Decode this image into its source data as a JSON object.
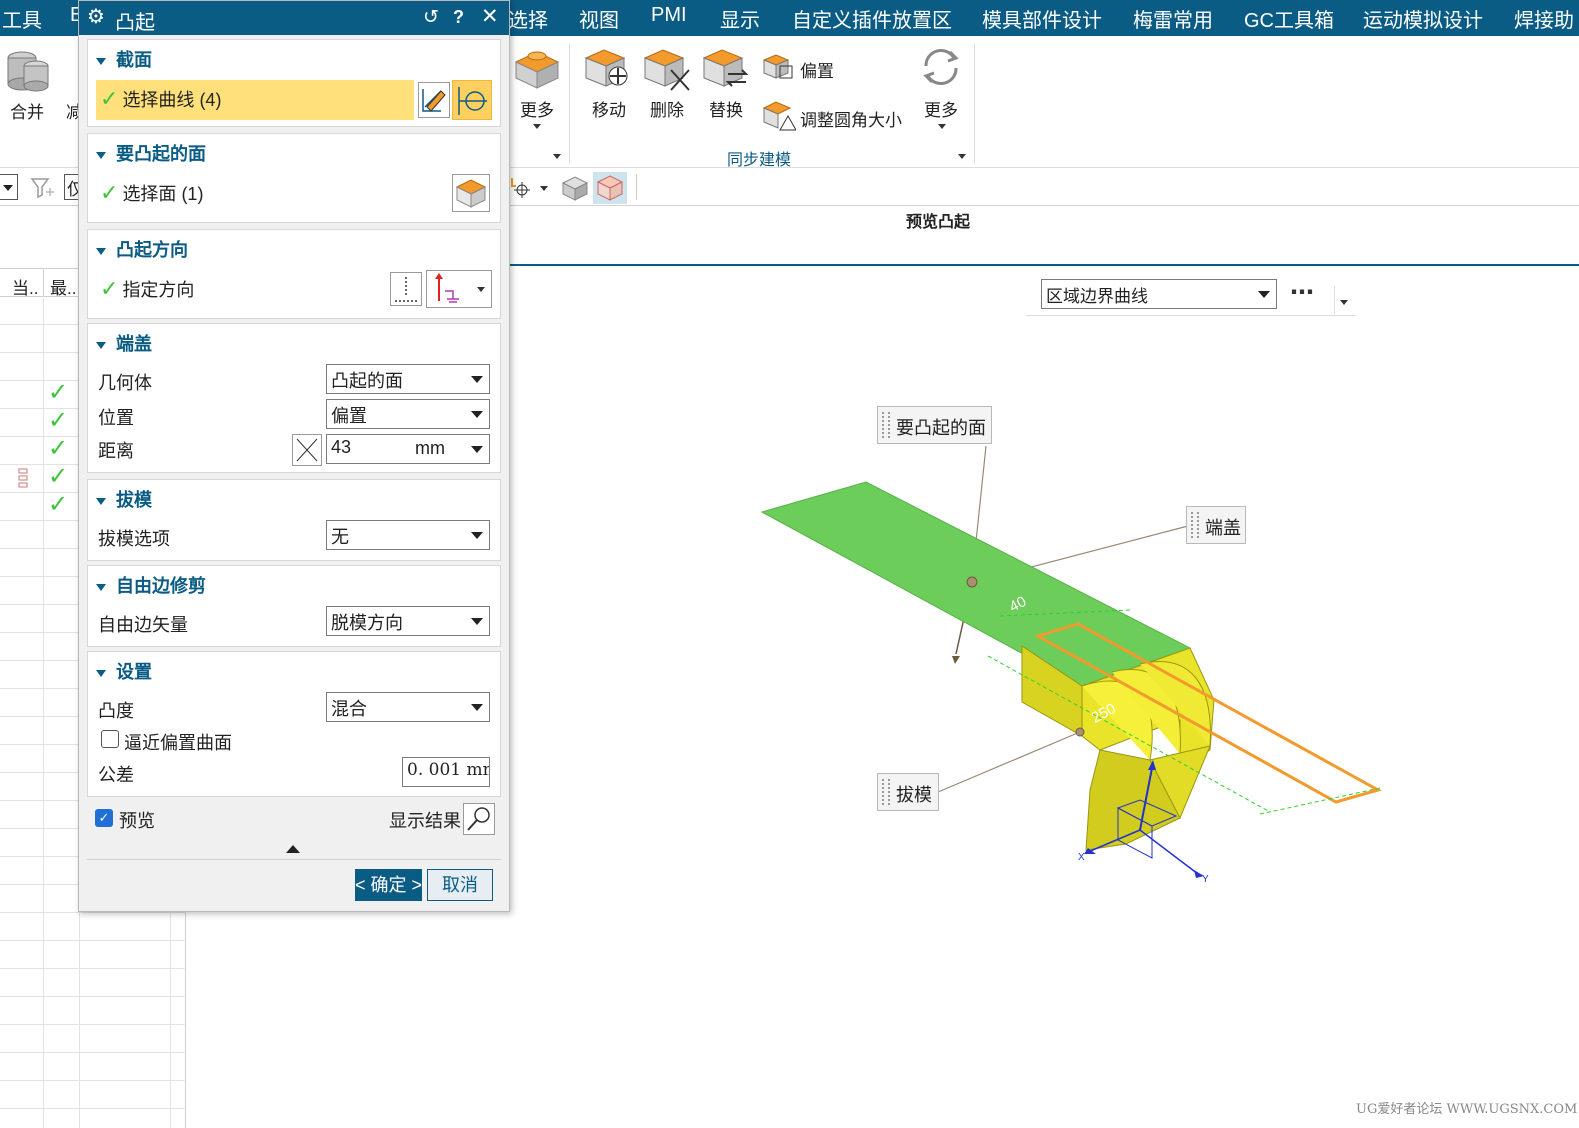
{
  "menubar": {
    "items_left": [
      "工具",
      "E"
    ],
    "items_right": [
      "选择",
      "视图",
      "PMI",
      "显示",
      "自定义插件放置区",
      "模具部件设计",
      "梅雷常用",
      "GC工具箱",
      "运动模拟设计",
      "焊接助"
    ]
  },
  "ribbon": {
    "unite_label": "合并",
    "subtract_label": "减",
    "more_label": "更多",
    "move_label": "移动",
    "delete_label": "删除",
    "replace_label": "替换",
    "offset_label": "偏置",
    "resize_blend_label": "调整圆角大小",
    "more2_label": "更多",
    "group_sync": "同步建模"
  },
  "toolbar2": {
    "filter_text": "仅"
  },
  "left_pane": {
    "col_current": "当..",
    "col_latest": "最.."
  },
  "viewport": {
    "preview_title": "预览凸起",
    "region_select": "区域边界曲线",
    "more_dots": "⋯",
    "callouts": {
      "face": "要凸起的面",
      "cap": "端盖",
      "draft": "拔模"
    },
    "dims": {
      "width": "40",
      "length": "250"
    },
    "triad": {
      "x": "X",
      "y": "Y"
    }
  },
  "dialog": {
    "title": "凸起",
    "section": {
      "header": "截面",
      "select_curve": "选择曲线 (4)"
    },
    "face": {
      "header": "要凸起的面",
      "select_face": "选择面 (1)"
    },
    "direction": {
      "header": "凸起方向",
      "specify": "指定方向"
    },
    "cap": {
      "header": "端盖",
      "geometry_label": "几何体",
      "geometry_value": "凸起的面",
      "location_label": "位置",
      "location_value": "偏置",
      "distance_label": "距离",
      "distance_value": "43",
      "distance_unit": "mm"
    },
    "draft": {
      "header": "拔模",
      "option_label": "拔模选项",
      "option_value": "无"
    },
    "free_edge": {
      "header": "自由边修剪",
      "vector_label": "自由边矢量",
      "vector_value": "脱模方向"
    },
    "settings": {
      "header": "设置",
      "convexity_label": "凸度",
      "convexity_value": "混合",
      "approx_label": "逼近偏置曲面",
      "tolerance_label": "公差",
      "tolerance_value": "0. 001 mm"
    },
    "preview_label": "预览",
    "show_result_label": "显示结果",
    "ok_label": "< 确定 >",
    "cancel_label": "取消"
  },
  "watermark": "UG爱好者论坛 WWW.UGSNX.COM"
}
